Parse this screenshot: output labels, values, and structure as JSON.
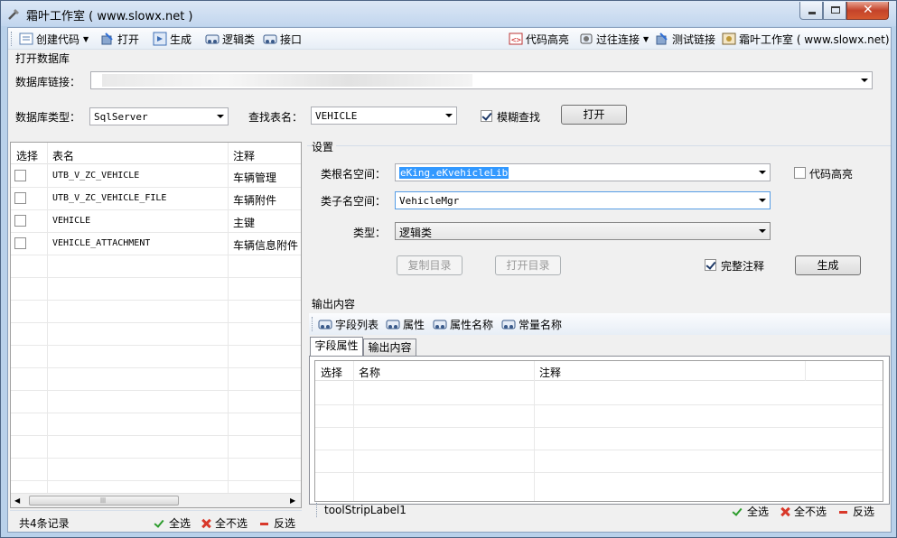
{
  "window": {
    "title": "霜叶工作室 ( www.slowx.net )"
  },
  "toolbar": {
    "items": [
      {
        "label": "创建代码",
        "icon": "code-create-icon",
        "dropdown": true
      },
      {
        "label": "打开",
        "icon": "open-icon"
      },
      {
        "label": "生成",
        "icon": "generate-icon"
      },
      {
        "label": "逻辑类",
        "icon": "logic-class-icon"
      },
      {
        "label": "接口",
        "icon": "interface-icon"
      }
    ],
    "right_items": [
      {
        "label": "代码高亮",
        "icon": "highlight-icon"
      },
      {
        "label": "过往连接",
        "icon": "history-connection-icon",
        "dropdown": true
      },
      {
        "label": "测试链接",
        "icon": "test-link-icon"
      },
      {
        "label": "霜叶工作室 ( www.slowx.net)",
        "icon": "studio-icon"
      }
    ]
  },
  "open_db": {
    "group_title": "打开数据库",
    "conn_label": "数据库链接：",
    "conn_value": "",
    "type_label": "数据库类型：",
    "type_value": "SqlServer",
    "table_label": "查找表名：",
    "table_value": "VEHICLE",
    "fuzzy_label": "模糊查找",
    "fuzzy_checked": true,
    "open_button": "打开"
  },
  "left_grid": {
    "columns": [
      "选择",
      "表名",
      "注释"
    ],
    "rows": [
      {
        "name": "UTB_V_ZC_VEHICLE",
        "comment": "车辆管理",
        "checked": false
      },
      {
        "name": "UTB_V_ZC_VEHICLE_FILE",
        "comment": "车辆附件",
        "checked": false
      },
      {
        "name": "VEHICLE",
        "comment": "主键",
        "checked": false
      },
      {
        "name": "VEHICLE_ATTACHMENT",
        "comment": "车辆信息附件",
        "checked": false
      }
    ]
  },
  "left_status": {
    "count": "共4条记录",
    "select_all": "全选",
    "select_none": "全不选",
    "invert": "反选"
  },
  "settings": {
    "group_title": "设置",
    "root_ns_label": "类根名空间：",
    "root_ns_value": "eKing.eKvehicleLib",
    "sub_ns_label": "类子名空间：",
    "sub_ns_value": "VehicleMgr",
    "type_label": "类型：",
    "type_value": "逻辑类",
    "highlight_label": "代码高亮",
    "highlight_checked": false,
    "copy_dir": "复制目录",
    "open_dir": "打开目录",
    "full_comment_label": "完整注释",
    "full_comment_checked": true,
    "generate_button": "生成"
  },
  "output": {
    "group_title": "输出内容",
    "tools": [
      {
        "label": "字段列表",
        "icon": "field-list-icon"
      },
      {
        "label": "属性",
        "icon": "property-icon"
      },
      {
        "label": "属性名称",
        "icon": "property-name-icon"
      },
      {
        "label": "常量名称",
        "icon": "constant-name-icon"
      }
    ],
    "tabs": [
      "字段属性",
      "输出内容"
    ],
    "columns": [
      "选择",
      "名称",
      "注释"
    ],
    "status_label": "toolStripLabel1",
    "select_all": "全选",
    "select_none": "全不选",
    "invert": "反选"
  }
}
